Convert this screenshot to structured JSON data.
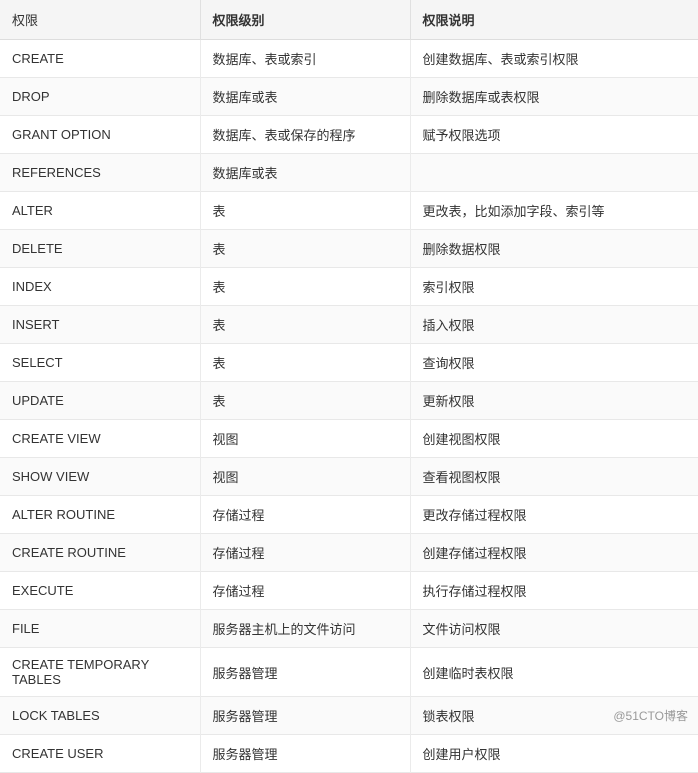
{
  "table": {
    "headers": [
      "权限",
      "权限级别",
      "权限说明"
    ],
    "rows": [
      {
        "privilege": "CREATE",
        "level": "数据库、表或索引",
        "description": "创建数据库、表或索引权限"
      },
      {
        "privilege": "DROP",
        "level": "数据库或表",
        "description": "删除数据库或表权限"
      },
      {
        "privilege": "GRANT OPTION",
        "level": "数据库、表或保存的程序",
        "description": "赋予权限选项"
      },
      {
        "privilege": "REFERENCES",
        "level": "数据库或表",
        "description": ""
      },
      {
        "privilege": "ALTER",
        "level": "表",
        "description": "更改表，比如添加字段、索引等"
      },
      {
        "privilege": "DELETE",
        "level": "表",
        "description": "删除数据权限"
      },
      {
        "privilege": "INDEX",
        "level": "表",
        "description": "索引权限"
      },
      {
        "privilege": "INSERT",
        "level": "表",
        "description": "插入权限"
      },
      {
        "privilege": "SELECT",
        "level": "表",
        "description": "查询权限"
      },
      {
        "privilege": "UPDATE",
        "level": "表",
        "description": "更新权限"
      },
      {
        "privilege": "CREATE VIEW",
        "level": "视图",
        "description": "创建视图权限"
      },
      {
        "privilege": "SHOW VIEW",
        "level": "视图",
        "description": "查看视图权限"
      },
      {
        "privilege": "ALTER ROUTINE",
        "level": "存储过程",
        "description": "更改存储过程权限"
      },
      {
        "privilege": "CREATE ROUTINE",
        "level": "存储过程",
        "description": "创建存储过程权限"
      },
      {
        "privilege": "EXECUTE",
        "level": "存储过程",
        "description": "执行存储过程权限"
      },
      {
        "privilege": "FILE",
        "level": "服务器主机上的文件访问",
        "description": "文件访问权限"
      },
      {
        "privilege": "CREATE TEMPORARY TABLES",
        "level": "服务器管理",
        "description": "创建临时表权限"
      },
      {
        "privilege": "LOCK TABLES",
        "level": "服务器管理",
        "description": "锁表权限"
      },
      {
        "privilege": "CREATE USER",
        "level": "服务器管理",
        "description": "创建用户权限"
      }
    ]
  },
  "watermark": "@51CTO博客"
}
